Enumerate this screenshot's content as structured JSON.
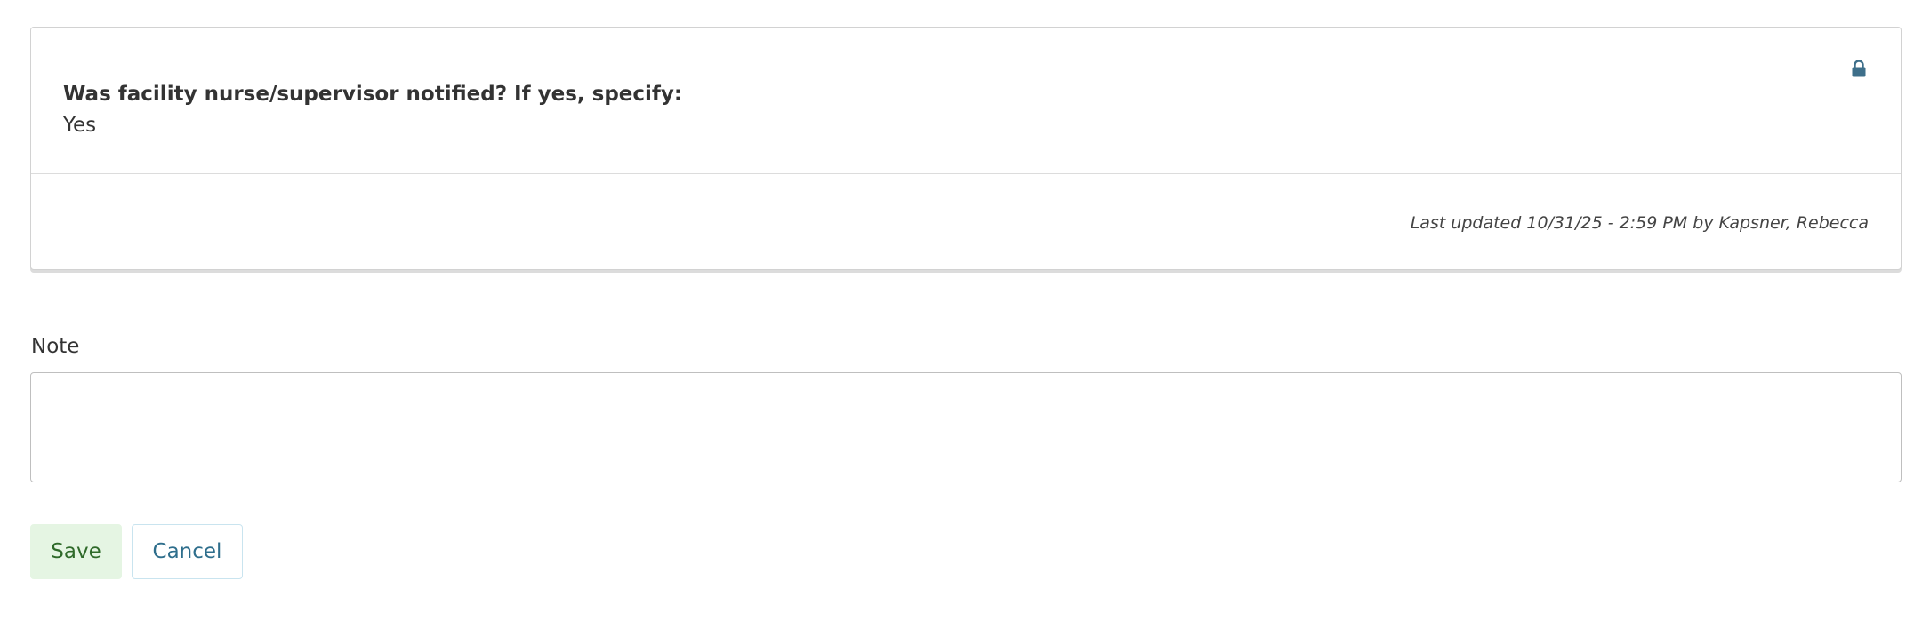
{
  "record": {
    "question": "Was facility nurse/supervisor notified? If yes, specify:",
    "answer": "Yes",
    "last_updated": "Last updated 10/31/25 - 2:59 PM by Kapsner, Rebecca",
    "locked_icon": "lock-icon"
  },
  "note": {
    "label": "Note",
    "value": "",
    "placeholder": ""
  },
  "actions": {
    "save_label": "Save",
    "cancel_label": "Cancel"
  },
  "colors": {
    "lock_icon": "#3e6f8a",
    "save_bg": "#e5f5e3",
    "save_text": "#2f6a2a",
    "cancel_text": "#2e6e8c",
    "cancel_border": "#c9e4ef"
  }
}
